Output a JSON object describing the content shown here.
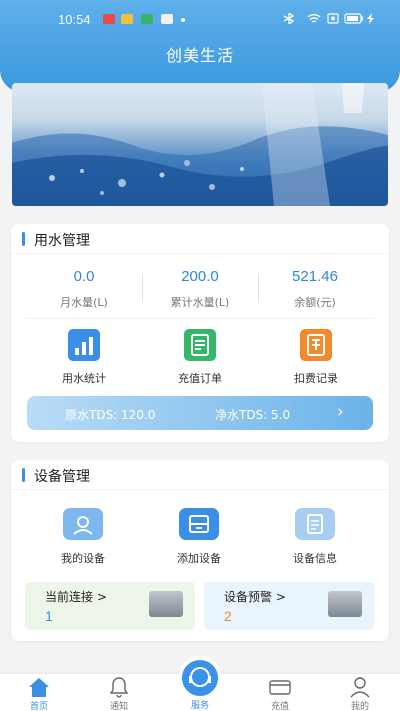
{
  "status_bar": {
    "time": "10:54"
  },
  "header": {
    "title": "创美生活"
  },
  "water": {
    "section_title": "用水管理",
    "stats": [
      {
        "value": "0.0",
        "label": "月水量(L)"
      },
      {
        "value": "200.0",
        "label": "累计水量(L)"
      },
      {
        "value": "521.46",
        "label": "余额(元)"
      }
    ],
    "functions": [
      {
        "label": "用水统计",
        "icon": "chart-icon",
        "color": "#3a8ee6"
      },
      {
        "label": "充值订单",
        "icon": "order-icon",
        "color": "#35b76a"
      },
      {
        "label": "扣费记录",
        "icon": "record-icon",
        "color": "#f08a2c"
      }
    ],
    "tds": {
      "raw": "原水TDS: 120.0",
      "pure": "净水TDS: 5.0",
      "arrow": "›"
    }
  },
  "device": {
    "section_title": "设备管理",
    "functions": [
      {
        "label": "我的设备",
        "icon": "device-icon"
      },
      {
        "label": "添加设备",
        "icon": "add-device-icon"
      },
      {
        "label": "设备信息",
        "icon": "info-icon"
      }
    ],
    "connect": {
      "label": "当前连接 >",
      "value": "1"
    },
    "alert": {
      "label": "设备预警 >",
      "value": "2"
    }
  },
  "tabs": [
    {
      "label": "首页",
      "icon": "home-icon",
      "active": true
    },
    {
      "label": "通知",
      "icon": "bell-icon",
      "active": false
    },
    {
      "label": "服务",
      "icon": "service-icon",
      "active": false
    },
    {
      "label": "充值",
      "icon": "card-icon",
      "active": false
    },
    {
      "label": "我的",
      "icon": "user-icon",
      "active": false
    }
  ],
  "colors": {
    "primary": "#3a8ee6",
    "orange": "#f08a2c",
    "green": "#35b76a"
  }
}
